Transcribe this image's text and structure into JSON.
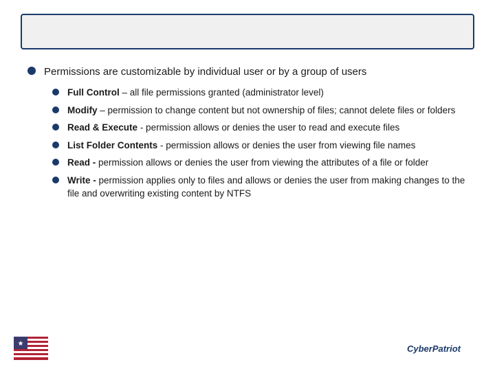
{
  "slide": {
    "topbar": "",
    "main_bullet": {
      "text": "Permissions are customizable by individual user or by a group of users"
    },
    "sub_items": [
      {
        "label": "Full Control",
        "separator": " – ",
        "text": "all file permissions granted (administrator level)"
      },
      {
        "label": "Modify",
        "separator": " – ",
        "text": "permission to change content but not ownership of files; cannot delete files or folders"
      },
      {
        "label": "Read & Execute",
        "separator": "  - ",
        "text": "permission allows or denies the user to read and execute files"
      },
      {
        "label": "List Folder Contents",
        "separator": "  - ",
        "text": "permission allows or denies the user from viewing file names"
      },
      {
        "label": "Read -",
        "separator": " ",
        "text": "permission allows or denies the user from viewing the attributes of a file or folder"
      },
      {
        "label": "Write -",
        "separator": " ",
        "text": "permission applies only to files and allows or denies the user from making changes to the file and overwriting existing content by NTFS"
      }
    ],
    "footer": {
      "brand": "CyberPatriot"
    }
  }
}
